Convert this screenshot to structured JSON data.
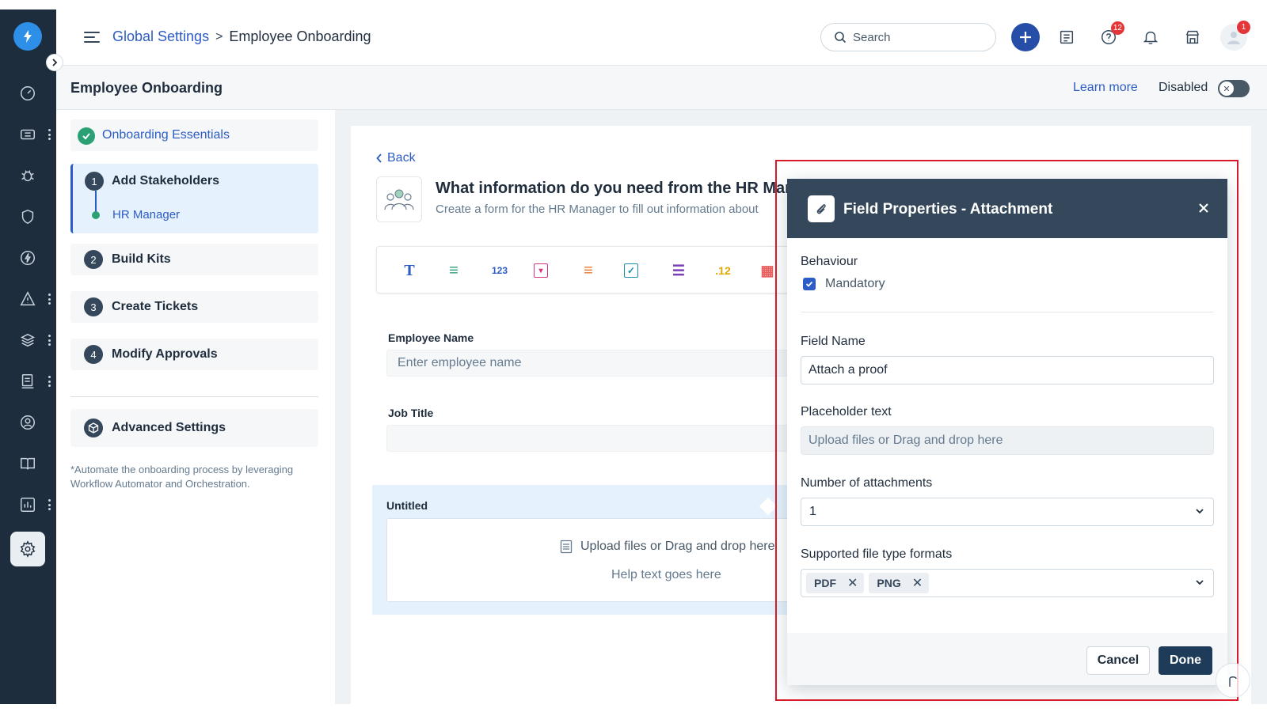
{
  "header": {
    "breadcrumb_parent": "Global Settings",
    "breadcrumb_separator": ">",
    "breadcrumb_current": "Employee Onboarding",
    "search_placeholder": "Search",
    "help_badge": "12",
    "avatar_badge": "1"
  },
  "subheader": {
    "title": "Employee Onboarding",
    "learn_more": "Learn more",
    "status_label": "Disabled",
    "toggle_state": "off"
  },
  "steps": {
    "essentials": "Onboarding Essentials",
    "items": [
      {
        "num": "1",
        "label": "Add Stakeholders",
        "sub": "HR Manager"
      },
      {
        "num": "2",
        "label": "Build Kits"
      },
      {
        "num": "3",
        "label": "Create Tickets"
      },
      {
        "num": "4",
        "label": "Modify Approvals"
      }
    ],
    "advanced": "Advanced Settings",
    "note": "*Automate the onboarding process by leveraging Workflow Automator and Orchestration."
  },
  "form": {
    "back": "Back",
    "question": "What information do you need from the HR Man",
    "question_sub": "Create a form for the HR Manager to fill out information about",
    "toolbar": [
      "T",
      "≡",
      "123",
      "▾",
      "≡",
      "✓",
      "☰",
      ".12",
      "▦"
    ],
    "fields": [
      {
        "label": "Employee Name",
        "placeholder": "Enter employee name"
      },
      {
        "label": "Job Title",
        "placeholder": ""
      }
    ],
    "attachment": {
      "label": "Untitled",
      "drop_text": "Upload files or Drag and drop here",
      "help_text": "Help text goes here"
    }
  },
  "panel": {
    "title": "Field Properties - Attachment",
    "behaviour_label": "Behaviour",
    "mandatory_label": "Mandatory",
    "mandatory_checked": true,
    "field_name_label": "Field Name",
    "field_name_value": "Attach a proof",
    "placeholder_label": "Placeholder text",
    "placeholder_value": "Upload files or Drag and drop here",
    "attachments_label": "Number of attachments",
    "attachments_value": "1",
    "formats_label": "Supported file type formats",
    "formats": [
      "PDF",
      "PNG"
    ],
    "cancel": "Cancel",
    "done": "Done"
  },
  "colors": {
    "rail": "#1e2d3d",
    "primary": "#2c5cc5",
    "panel_header": "#34475b",
    "highlight": "#d7192a",
    "success": "#2ba074"
  }
}
